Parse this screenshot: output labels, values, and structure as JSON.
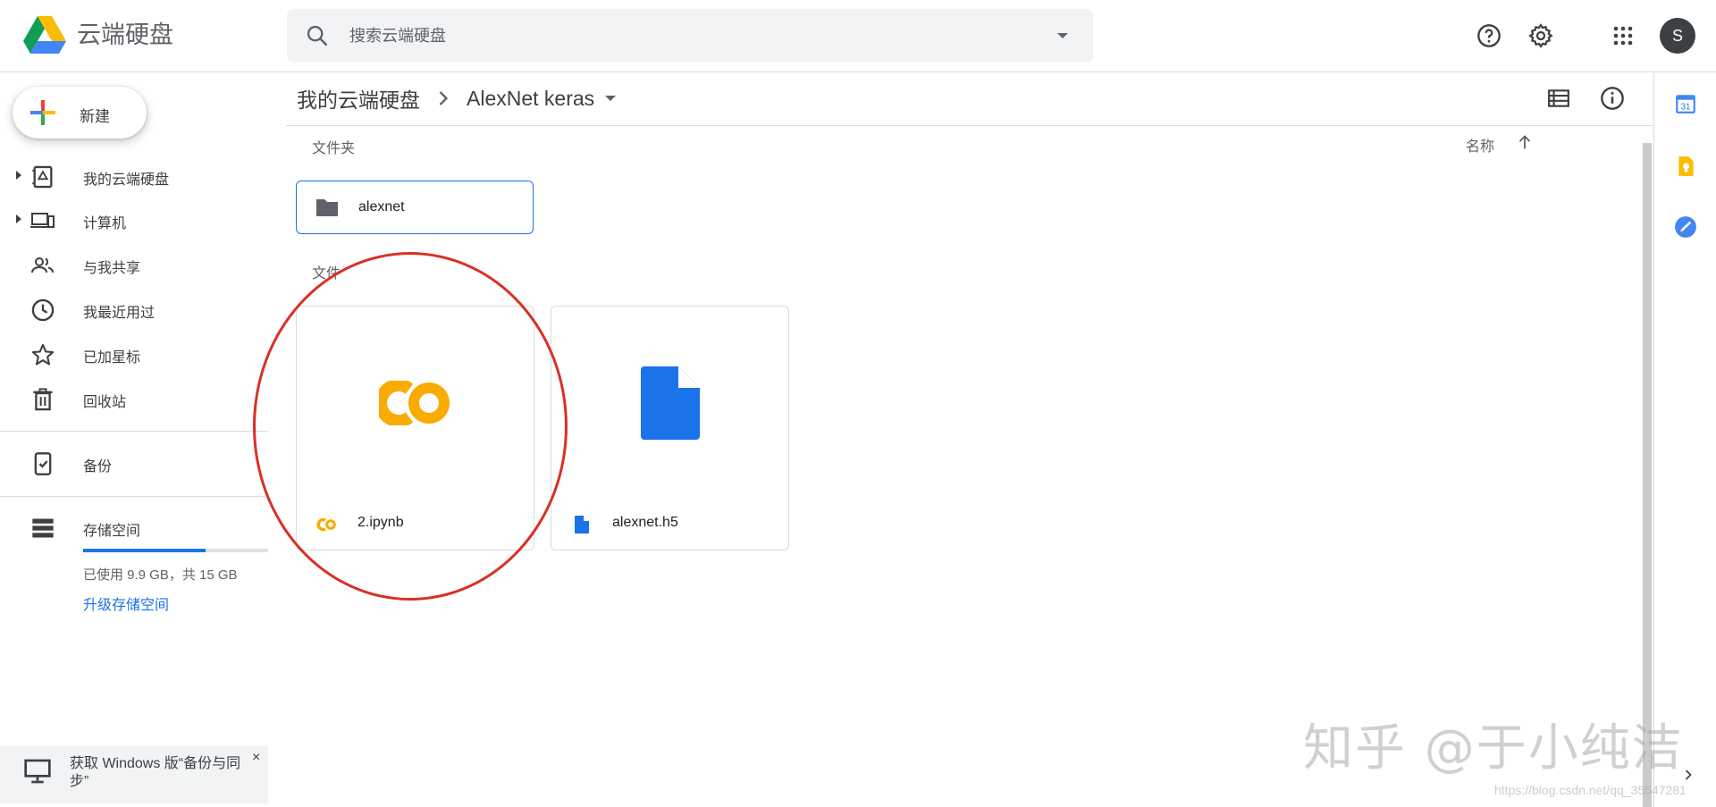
{
  "header": {
    "app_title": "云端硬盘",
    "search_placeholder": "搜索云端硬盘",
    "help_icon": "help-icon",
    "settings_icon": "gear-icon",
    "apps_icon": "apps-grid-icon",
    "avatar_initial": "S"
  },
  "sidebar": {
    "new_label": "新建",
    "items": [
      {
        "label": "我的云端硬盘",
        "icon": "my-drive-icon",
        "expandable": true
      },
      {
        "label": "计算机",
        "icon": "computer-icon",
        "expandable": true
      },
      {
        "label": "与我共享",
        "icon": "shared-people-icon",
        "expandable": false
      },
      {
        "label": "我最近用过",
        "icon": "clock-icon",
        "expandable": false
      },
      {
        "label": "已加星标",
        "icon": "star-icon",
        "expandable": false
      },
      {
        "label": "回收站",
        "icon": "trash-icon",
        "expandable": false
      }
    ],
    "backup_label": "备份",
    "storage_label": "存储空间",
    "storage_used_text": "已使用 9.9 GB，共 15 GB",
    "storage_fraction": 0.66,
    "upgrade_label": "升级存储空间",
    "promo_text": "获取 Windows 版“备份与同步”",
    "promo_close": "×"
  },
  "main": {
    "breadcrumb": [
      "我的云端硬盘",
      "AlexNet keras"
    ],
    "folders_heading": "文件夹",
    "files_heading": "文件",
    "sort_label": "名称",
    "folders": [
      {
        "name": "alexnet"
      }
    ],
    "files": [
      {
        "name": "2.ipynb",
        "type": "colab"
      },
      {
        "name": "alexnet.h5",
        "type": "generic"
      }
    ]
  },
  "watermark": {
    "text": "知乎 @于小纯洁",
    "url": "https://blog.csdn.net/qq_35547281"
  },
  "colors": {
    "accent": "#1a73e8",
    "highlight": "#d93025",
    "colab_yellow": "#f9ab00"
  }
}
